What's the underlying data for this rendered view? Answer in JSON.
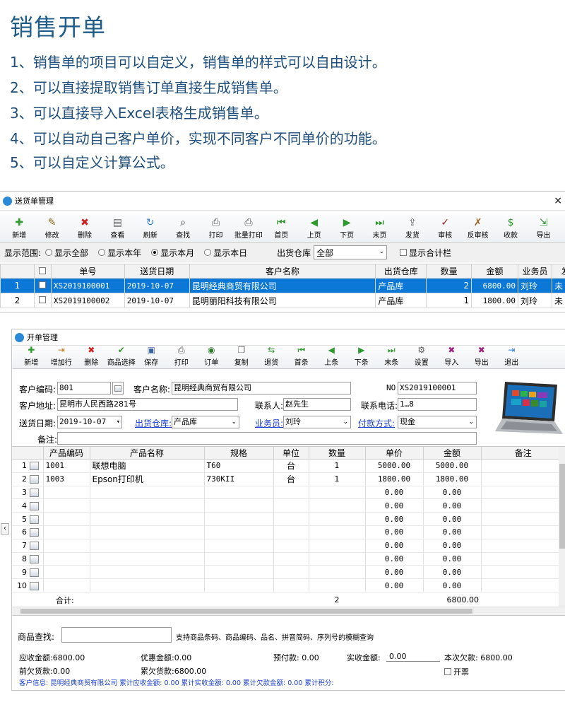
{
  "header": {
    "title": "销售开单",
    "lines": [
      "1、销售单的项目可以自定义，销售单的样式可以自由设计。",
      "2、可以直接提取销售订单直接生成销售单。",
      "3、可以直接导入Excel表格生成销售单。",
      "4、可以自动自己客户单价，实现不同客户不同单价的功能。",
      "5、可以自定义计算公式。"
    ]
  },
  "delivery_window": {
    "title": "送货单管理",
    "close": "×",
    "toolbar": [
      {
        "label": "新增",
        "icon": "plus-icon",
        "glyph": "✚",
        "color": "#2e9a2e"
      },
      {
        "label": "修改",
        "icon": "edit-icon",
        "glyph": "✎",
        "color": "#8a6a1a"
      },
      {
        "label": "删除",
        "icon": "delete-icon",
        "glyph": "✖",
        "color": "#d02020"
      },
      {
        "label": "查看",
        "icon": "view-icon",
        "glyph": "▤",
        "color": "#666666"
      },
      {
        "label": "刷新",
        "icon": "refresh-icon",
        "glyph": "↻",
        "color": "#2a7fd0"
      },
      {
        "label": "查找",
        "icon": "binoculars-icon",
        "glyph": "⌕",
        "color": "#333333"
      },
      {
        "label": "打印",
        "icon": "printer-icon",
        "glyph": "⎙",
        "color": "#555555"
      },
      {
        "label": "批量打印",
        "icon": "batch-print-icon",
        "glyph": "⎙",
        "color": "#555555"
      },
      {
        "label": "首页",
        "icon": "first-page-icon",
        "glyph": "⏮",
        "color": "#2e9a2e"
      },
      {
        "label": "上页",
        "icon": "prev-page-icon",
        "glyph": "◀",
        "color": "#2e9a2e"
      },
      {
        "label": "下页",
        "icon": "next-page-icon",
        "glyph": "▶",
        "color": "#2e9a2e"
      },
      {
        "label": "末页",
        "icon": "last-page-icon",
        "glyph": "⏭",
        "color": "#2e9a2e"
      },
      {
        "label": "发货",
        "icon": "ship-icon",
        "glyph": "⇪",
        "color": "#666666"
      },
      {
        "label": "审核",
        "icon": "approve-icon",
        "glyph": "✓",
        "color": "#a02020"
      },
      {
        "label": "反审核",
        "icon": "unapprove-icon",
        "glyph": "✗",
        "color": "#a06020"
      },
      {
        "label": "收款",
        "icon": "dollar-icon",
        "glyph": "$",
        "color": "#2e9a2e"
      },
      {
        "label": "导出",
        "icon": "export-icon",
        "glyph": "⇲",
        "color": "#2e9a2e"
      }
    ],
    "filter": {
      "label": "显示范围:",
      "options": [
        "显示全部",
        "显示本年",
        "显示本月",
        "显示本日"
      ],
      "selected_index": 2,
      "warehouse_label": "出货仓库",
      "warehouse_value": "全部",
      "total_checkbox": "显示合计栏"
    },
    "columns": [
      "单号",
      "送货日期",
      "客户名称",
      "出货仓库",
      "数量",
      "金额",
      "业务员",
      "发"
    ],
    "rows": [
      {
        "idx": "1",
        "no": "XS2019100001",
        "date": "2019-10-07",
        "customer": "昆明经典商贸有限公司",
        "warehouse": "产品库",
        "qty": "2",
        "amount": "6800.00",
        "salesman": "刘玲",
        "flag": "未"
      },
      {
        "idx": "2",
        "no": "XS2019100002",
        "date": "2019-10-07",
        "customer": "昆明丽阳科技有限公司",
        "warehouse": "产品库",
        "qty": "1",
        "amount": "1800.00",
        "salesman": "刘玲",
        "flag": "未"
      }
    ]
  },
  "order_window": {
    "title": "开单管理",
    "toolbar": [
      {
        "label": "新增",
        "icon": "plus-icon",
        "glyph": "✚",
        "color": "#2e9a2e"
      },
      {
        "label": "增加行",
        "icon": "add-row-icon",
        "glyph": "⇥",
        "color": "#c08020"
      },
      {
        "label": "删除",
        "icon": "delete-icon",
        "glyph": "✖",
        "color": "#d02020"
      },
      {
        "label": "商品选择",
        "icon": "check-icon",
        "glyph": "✔",
        "color": "#2e9a2e"
      },
      {
        "label": "保存",
        "icon": "save-icon",
        "glyph": "▣",
        "color": "#3a5fa0"
      },
      {
        "label": "打印",
        "icon": "printer-icon",
        "glyph": "⎙",
        "color": "#555555"
      },
      {
        "label": "订单",
        "icon": "order-icon",
        "glyph": "◉",
        "color": "#2e7a2e"
      },
      {
        "label": "复制",
        "icon": "copy-icon",
        "glyph": "❐",
        "color": "#666666"
      },
      {
        "label": "退货",
        "icon": "return-icon",
        "glyph": "⇆",
        "color": "#2e9a2e"
      },
      {
        "label": "首条",
        "icon": "first-record-icon",
        "glyph": "⏮",
        "color": "#2e9a2e"
      },
      {
        "label": "上条",
        "icon": "prev-record-icon",
        "glyph": "◀",
        "color": "#2e9a2e"
      },
      {
        "label": "下条",
        "icon": "next-record-icon",
        "glyph": "▶",
        "color": "#2e9a2e"
      },
      {
        "label": "末条",
        "icon": "last-record-icon",
        "glyph": "⏭",
        "color": "#2e9a2e"
      },
      {
        "label": "设置",
        "icon": "settings-icon",
        "glyph": "⚙",
        "color": "#555555"
      },
      {
        "label": "导入",
        "icon": "import-icon",
        "glyph": "✖",
        "color": "#a02080"
      },
      {
        "label": "导出",
        "icon": "export-icon",
        "glyph": "✖",
        "color": "#a02080"
      },
      {
        "label": "退出",
        "icon": "exit-icon",
        "glyph": "⇥",
        "color": "#2a7fd0"
      }
    ],
    "form": {
      "customer_code_label": "客户编码:",
      "customer_code": "801",
      "customer_name_label": "客户名称:",
      "customer_name": "昆明经典商贸有限公司",
      "no_label": "NO:",
      "no": "XS2019100001",
      "address_label": "客户地址:",
      "address": "昆明市人民西路281号",
      "contact_label": "联系人:",
      "contact": "赵先生",
      "phone_label": "联系电话:",
      "phone": "1…8",
      "date_label": "送货日期:",
      "date": "2019-10-07",
      "warehouse_label": "出货仓库:",
      "warehouse": "产品库",
      "salesman_label": "业务员:",
      "salesman": "刘玲",
      "payment_label": "付款方式:",
      "payment": "现金",
      "remark_label": "备注:"
    },
    "columns": [
      "产品编码",
      "产品名称",
      "规格",
      "单位",
      "数量",
      "单价",
      "金额",
      "备注"
    ],
    "rows": [
      {
        "n": "1",
        "code": "1001",
        "name": "联想电脑",
        "spec": "T60",
        "unit": "台",
        "qty": "1",
        "price": "5000.00",
        "amount": "5000.00"
      },
      {
        "n": "2",
        "code": "1003",
        "name": "Epson打印机",
        "spec": "730KII",
        "unit": "台",
        "qty": "1",
        "price": "1800.00",
        "amount": "1800.00"
      },
      {
        "n": "3",
        "code": "",
        "name": "",
        "spec": "",
        "unit": "",
        "qty": "",
        "price": "0.00",
        "amount": "0.00"
      },
      {
        "n": "4",
        "code": "",
        "name": "",
        "spec": "",
        "unit": "",
        "qty": "",
        "price": "0.00",
        "amount": "0.00"
      },
      {
        "n": "5",
        "code": "",
        "name": "",
        "spec": "",
        "unit": "",
        "qty": "",
        "price": "0.00",
        "amount": "0.00"
      },
      {
        "n": "6",
        "code": "",
        "name": "",
        "spec": "",
        "unit": "",
        "qty": "",
        "price": "0.00",
        "amount": "0.00"
      },
      {
        "n": "7",
        "code": "",
        "name": "",
        "spec": "",
        "unit": "",
        "qty": "",
        "price": "0.00",
        "amount": "0.00"
      },
      {
        "n": "8",
        "code": "",
        "name": "",
        "spec": "",
        "unit": "",
        "qty": "",
        "price": "0.00",
        "amount": "0.00"
      },
      {
        "n": "9",
        "code": "",
        "name": "",
        "spec": "",
        "unit": "",
        "qty": "",
        "price": "0.00",
        "amount": "0.00"
      },
      {
        "n": "10",
        "code": "",
        "name": "",
        "spec": "",
        "unit": "",
        "qty": "",
        "price": "0.00",
        "amount": "0.00"
      }
    ],
    "totals": {
      "label": "合计:",
      "qty": "2",
      "amount": "6800.00"
    },
    "search": {
      "label": "商品查找:",
      "hint": "支持商品条码、商品编码、品名、拼音简码、序列号的模糊查询"
    },
    "summary": {
      "receivable": "应收金额:6800.00",
      "discount": "优惠金额:0.00",
      "prepaid": "预付款: 0.00",
      "received_label": "实收金额:",
      "received": "0.00",
      "owed": "本次欠款: 6800.00",
      "prev_owed": "前欠货款:0.00",
      "total_owed": "累欠货款:6800.00",
      "open_ticket": "开票",
      "info": "客户信息: 昆明经典商贸有限公司  累计应收金额: 0.00   累计实收金额: 0.00   累计欠款金额: 0.00   累计积分:"
    }
  },
  "colors": {
    "title_blue": "#1f5c88",
    "select_row": "#0b78d7",
    "link_blue": "#1a3fd0"
  }
}
